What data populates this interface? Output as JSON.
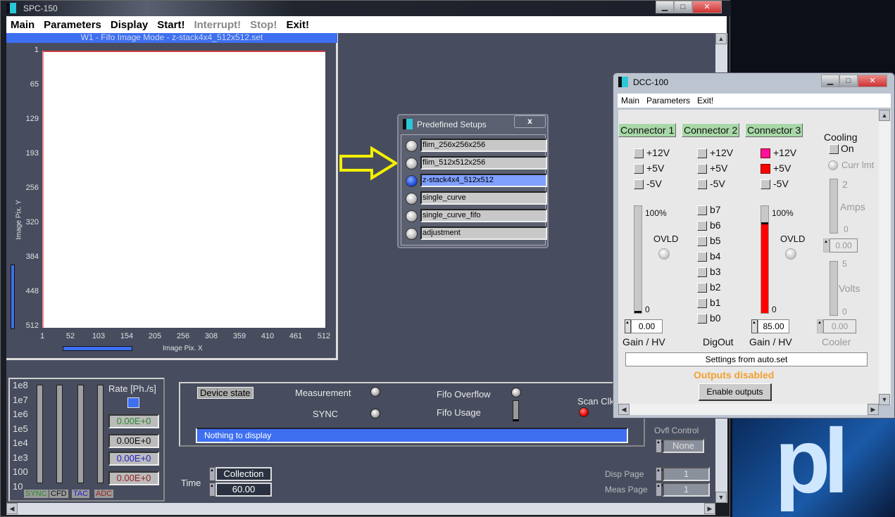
{
  "desktop": {
    "logo_text": "pl"
  },
  "spc": {
    "title": "SPC-150",
    "menu": [
      {
        "label": "Main",
        "enabled": true
      },
      {
        "label": "Parameters",
        "enabled": true
      },
      {
        "label": "Display",
        "enabled": true
      },
      {
        "label": "Start!",
        "enabled": true
      },
      {
        "label": "Interrupt!",
        "enabled": false
      },
      {
        "label": "Stop!",
        "enabled": false
      },
      {
        "label": "Exit!",
        "enabled": true
      }
    ],
    "plot": {
      "title": "W1 -  Fifo Image Mode - z-stack4x4_512x512.set",
      "ylabel": "Image Pix. Y",
      "xlabel": "Image Pix. X",
      "yticks": [
        "1",
        "65",
        "129",
        "193",
        "256",
        "320",
        "384",
        "448",
        "512"
      ],
      "xticks": [
        "1",
        "52",
        "103",
        "154",
        "205",
        "256",
        "308",
        "359",
        "410",
        "461",
        "512"
      ]
    },
    "rates": {
      "scale": [
        "1e8",
        "1e7",
        "1e6",
        "1e5",
        "1e4",
        "1e3",
        "100",
        "10"
      ],
      "title": "Rate [Ph./s]",
      "channels": [
        {
          "label": "SYNC",
          "value": "0.00E+0",
          "color": "#2a8a2a"
        },
        {
          "label": "CFD",
          "value": "0.00E+0",
          "color": "#111111"
        },
        {
          "label": "TAC",
          "value": "0.00E+0",
          "color": "#2222cc"
        },
        {
          "label": "ADC",
          "value": "0.00E+0",
          "color": "#992222"
        }
      ]
    },
    "state": {
      "device_state": "Device state",
      "measurement": "Measurement",
      "sync": "SYNC",
      "fifo_overflow": "Fifo Overflow",
      "fifo_usage": "Fifo Usage",
      "scan_clk": "Scan Clk",
      "message": "Nothing to display"
    },
    "time": {
      "label": "Time",
      "mode": "Collection",
      "value": "60.00"
    },
    "ovfl": {
      "label": "Ovfl Control",
      "value": "None"
    },
    "pages": {
      "disp_label": "Disp Page",
      "disp_value": "1",
      "meas_label": "Meas Page",
      "meas_value": "1"
    }
  },
  "predefined": {
    "title": "Predefined Setups",
    "close": "x",
    "items": [
      {
        "name": "flim_256x256x256",
        "selected": false
      },
      {
        "name": "flim_512x512x256",
        "selected": false
      },
      {
        "name": "z-stack4x4_512x512",
        "selected": true
      },
      {
        "name": "single_curve",
        "selected": false
      },
      {
        "name": "single_curve_fifo",
        "selected": false
      },
      {
        "name": "adjustment",
        "selected": false
      }
    ]
  },
  "dcc": {
    "title": "DCC-100",
    "menu": [
      "Main",
      "Parameters",
      "Exit!"
    ],
    "connectors": [
      {
        "label": "Connector 1",
        "v12": "+12V",
        "v5": "+5V",
        "vm5": "-5V",
        "v12_on": false,
        "v5_on": false,
        "max": "100%",
        "ovld": "OVLD",
        "min": "0",
        "gain": "0.00",
        "gain_label": "Gain / HV",
        "level_percent": 0
      },
      {
        "label": "Connector 2",
        "v12": "+12V",
        "v5": "+5V",
        "vm5": "-5V",
        "bits": [
          "b7",
          "b6",
          "b5",
          "b4",
          "b3",
          "b2",
          "b1",
          "b0"
        ],
        "footer": "DigOut"
      },
      {
        "label": "Connector 3",
        "v12": "+12V",
        "v5": "+5V",
        "vm5": "-5V",
        "v12_on": true,
        "v5_on": true,
        "max": "100%",
        "ovld": "OVLD",
        "min": "0",
        "gain": "85.00",
        "gain_label": "Gain / HV",
        "level_percent": 85
      }
    ],
    "cooling": {
      "title": "Cooling",
      "on": "On",
      "curr": "Curr lmt",
      "amps_max": "2",
      "amps": "Amps",
      "amps_min": "0",
      "amps_value": "0.00",
      "volts_max": "5",
      "volts": "Volts",
      "volts_min": "0",
      "volts_value": "0.00",
      "footer": "Cooler"
    },
    "settings": "Settings from auto.set",
    "status": "Outputs disabled",
    "status_color": "#f0a030",
    "enable": "Enable outputs"
  }
}
